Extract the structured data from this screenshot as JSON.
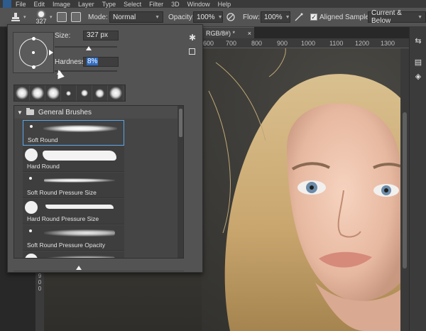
{
  "menu": [
    "File",
    "Edit",
    "Image",
    "Layer",
    "Type",
    "Select",
    "Filter",
    "3D",
    "Window",
    "Help"
  ],
  "options": {
    "brush_size": "327",
    "mode_label": "Mode:",
    "mode_value": "Normal",
    "opacity_label": "Opacity:",
    "opacity_value": "100%",
    "flow_label": "Flow:",
    "flow_value": "100%",
    "aligned_label": "Aligned",
    "sample_label": "Sample:",
    "sample_value": "Current & Below"
  },
  "document_tab": {
    "title": "RGB/8#) *",
    "close": "×"
  },
  "ruler": {
    "ticks": [
      "600",
      "700",
      "800",
      "900",
      "1000",
      "1100",
      "1200",
      "1300"
    ],
    "vertical": [
      "9",
      "0",
      "0"
    ]
  },
  "picker": {
    "size_label": "Size:",
    "size_value": "327 px",
    "size_fraction": 0.55,
    "hardness_label": "Hardness:",
    "hardness_value": "8%",
    "hardness_fraction": 0.08,
    "group_name": "General Brushes",
    "brushes": [
      {
        "name": "Soft Round"
      },
      {
        "name": "Hard Round"
      },
      {
        "name": "Soft Round Pressure Size"
      },
      {
        "name": "Hard Round Pressure Size"
      },
      {
        "name": "Soft Round Pressure Opacity"
      },
      {
        "name": ""
      }
    ]
  },
  "colors": {
    "selection": "#5aa6e8",
    "highlight": "#2f6cc6"
  }
}
